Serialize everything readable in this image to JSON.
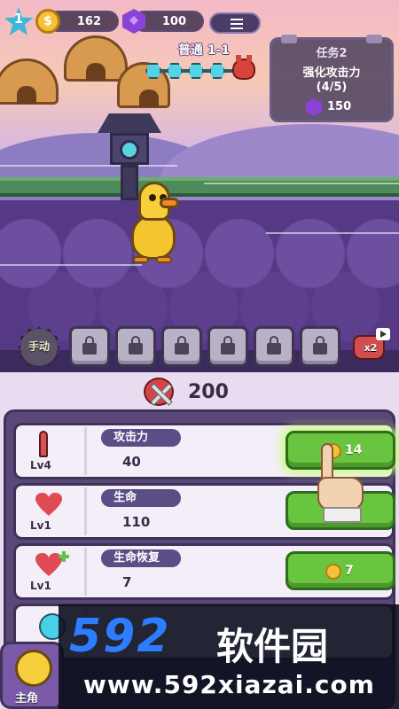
{
  "hud": {
    "level": "1",
    "coins": "162",
    "gems": "100"
  },
  "stage": {
    "title": "普通 1-1"
  },
  "task": {
    "title": "任务2",
    "description": "强化攻击力",
    "progress": "(4/5)",
    "reward": "150"
  },
  "slots": {
    "manual_label": "手动",
    "locked_count": 6,
    "speed_label": "x2"
  },
  "power": {
    "value": "200"
  },
  "upgrades": [
    {
      "name": "攻击力",
      "level": "Lv4",
      "value": "40",
      "cost": "14",
      "icon": "sword-icon"
    },
    {
      "name": "生命",
      "level": "Lv1",
      "value": "110",
      "cost": "",
      "icon": "heart-icon"
    },
    {
      "name": "生命恢复",
      "level": "Lv1",
      "value": "7",
      "cost": "7",
      "icon": "heart-plus-icon"
    },
    {
      "name": "",
      "level": "",
      "value": "",
      "cost": "",
      "icon": "lightning-icon"
    }
  ],
  "character_button": {
    "label": "主角"
  },
  "watermark": {
    "logo": "592",
    "name": "软件园",
    "url": "www.592xiazai.com"
  },
  "colors": {
    "upgrade_button": "#69c43f",
    "panel": "#5a4978",
    "name_pill": "#5b4d86"
  }
}
